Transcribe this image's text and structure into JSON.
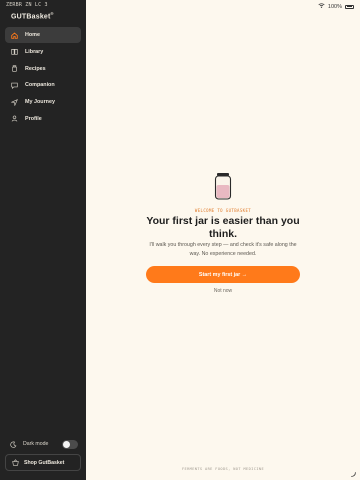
{
  "status": {
    "time": "ZERBR ZN LC 3",
    "battery": "100%"
  },
  "app": {
    "logo": "GUTBasket",
    "logo_mark": "®"
  },
  "sidebar": {
    "items": [
      {
        "label": "Home",
        "icon": "home-icon",
        "active": true
      },
      {
        "label": "Library",
        "icon": "book-icon",
        "active": false
      },
      {
        "label": "Recipes",
        "icon": "jar-icon",
        "active": false
      },
      {
        "label": "Companion",
        "icon": "chat-icon",
        "active": false
      },
      {
        "label": "My Journey",
        "icon": "navigation-icon",
        "active": false
      },
      {
        "label": "Profile",
        "icon": "user-icon",
        "active": false
      }
    ],
    "dark_mode_label": "Dark mode",
    "dark_mode_on": false,
    "shop_label": "Shop GutBasket"
  },
  "welcome": {
    "kicker": "WELCOME TO GUTBASKET",
    "headline": "Your first jar is easier than you think.",
    "subtitle": "I'll walk you through every step — and check it's safe along the way. No experience needed.",
    "cta": "Start my first jar →",
    "secondary": "Not now"
  },
  "footer": "FERMENTS ARE FOODS, NOT MEDICINE",
  "colors": {
    "accent": "#ff7a1a",
    "sidebar_bg": "#232323",
    "page_bg": "#fdf8ee"
  }
}
